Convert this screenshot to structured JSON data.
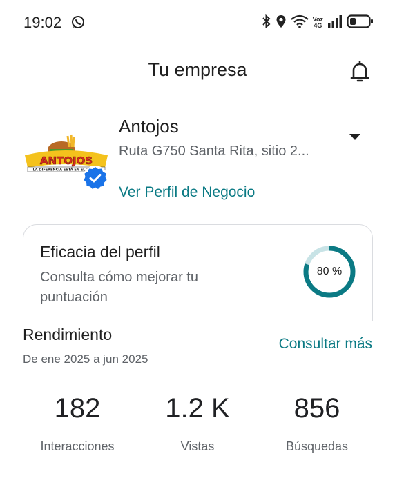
{
  "status_bar": {
    "time": "19:02",
    "network_label_top": "Voz",
    "network_label_bottom": "4G",
    "icons": [
      "whatsapp-icon",
      "bluetooth-icon",
      "location-icon",
      "wifi-icon",
      "signal-icon",
      "battery-icon"
    ]
  },
  "header": {
    "title": "Tu empresa",
    "bell_icon": "bell-icon"
  },
  "business": {
    "name": "Antojos",
    "address": "Ruta G750 Santa Rita, sitio 2...",
    "profile_link": "Ver Perfil de Negocio",
    "logo_text": "ANTOJOS",
    "logo_tagline": "LA DIFERENCIA ESTÁ EN EL SABOR"
  },
  "profile_card": {
    "title": "Eficacia del perfil",
    "subtitle": "Consulta cómo mejorar tu puntuación",
    "percent_label": "80 %",
    "percent_value": 0.8
  },
  "performance": {
    "title": "Rendimiento",
    "range": "De ene 2025 a jun 2025",
    "more_link": "Consultar más",
    "stats": [
      {
        "value": "182",
        "label": "Interacciones"
      },
      {
        "value": "1.2 K",
        "label": "Vistas"
      },
      {
        "value": "856",
        "label": "Búsquedas"
      }
    ]
  },
  "colors": {
    "accent": "#0b7a84",
    "ring_track": "#c8e3e6",
    "verified": "#1a73e8"
  }
}
